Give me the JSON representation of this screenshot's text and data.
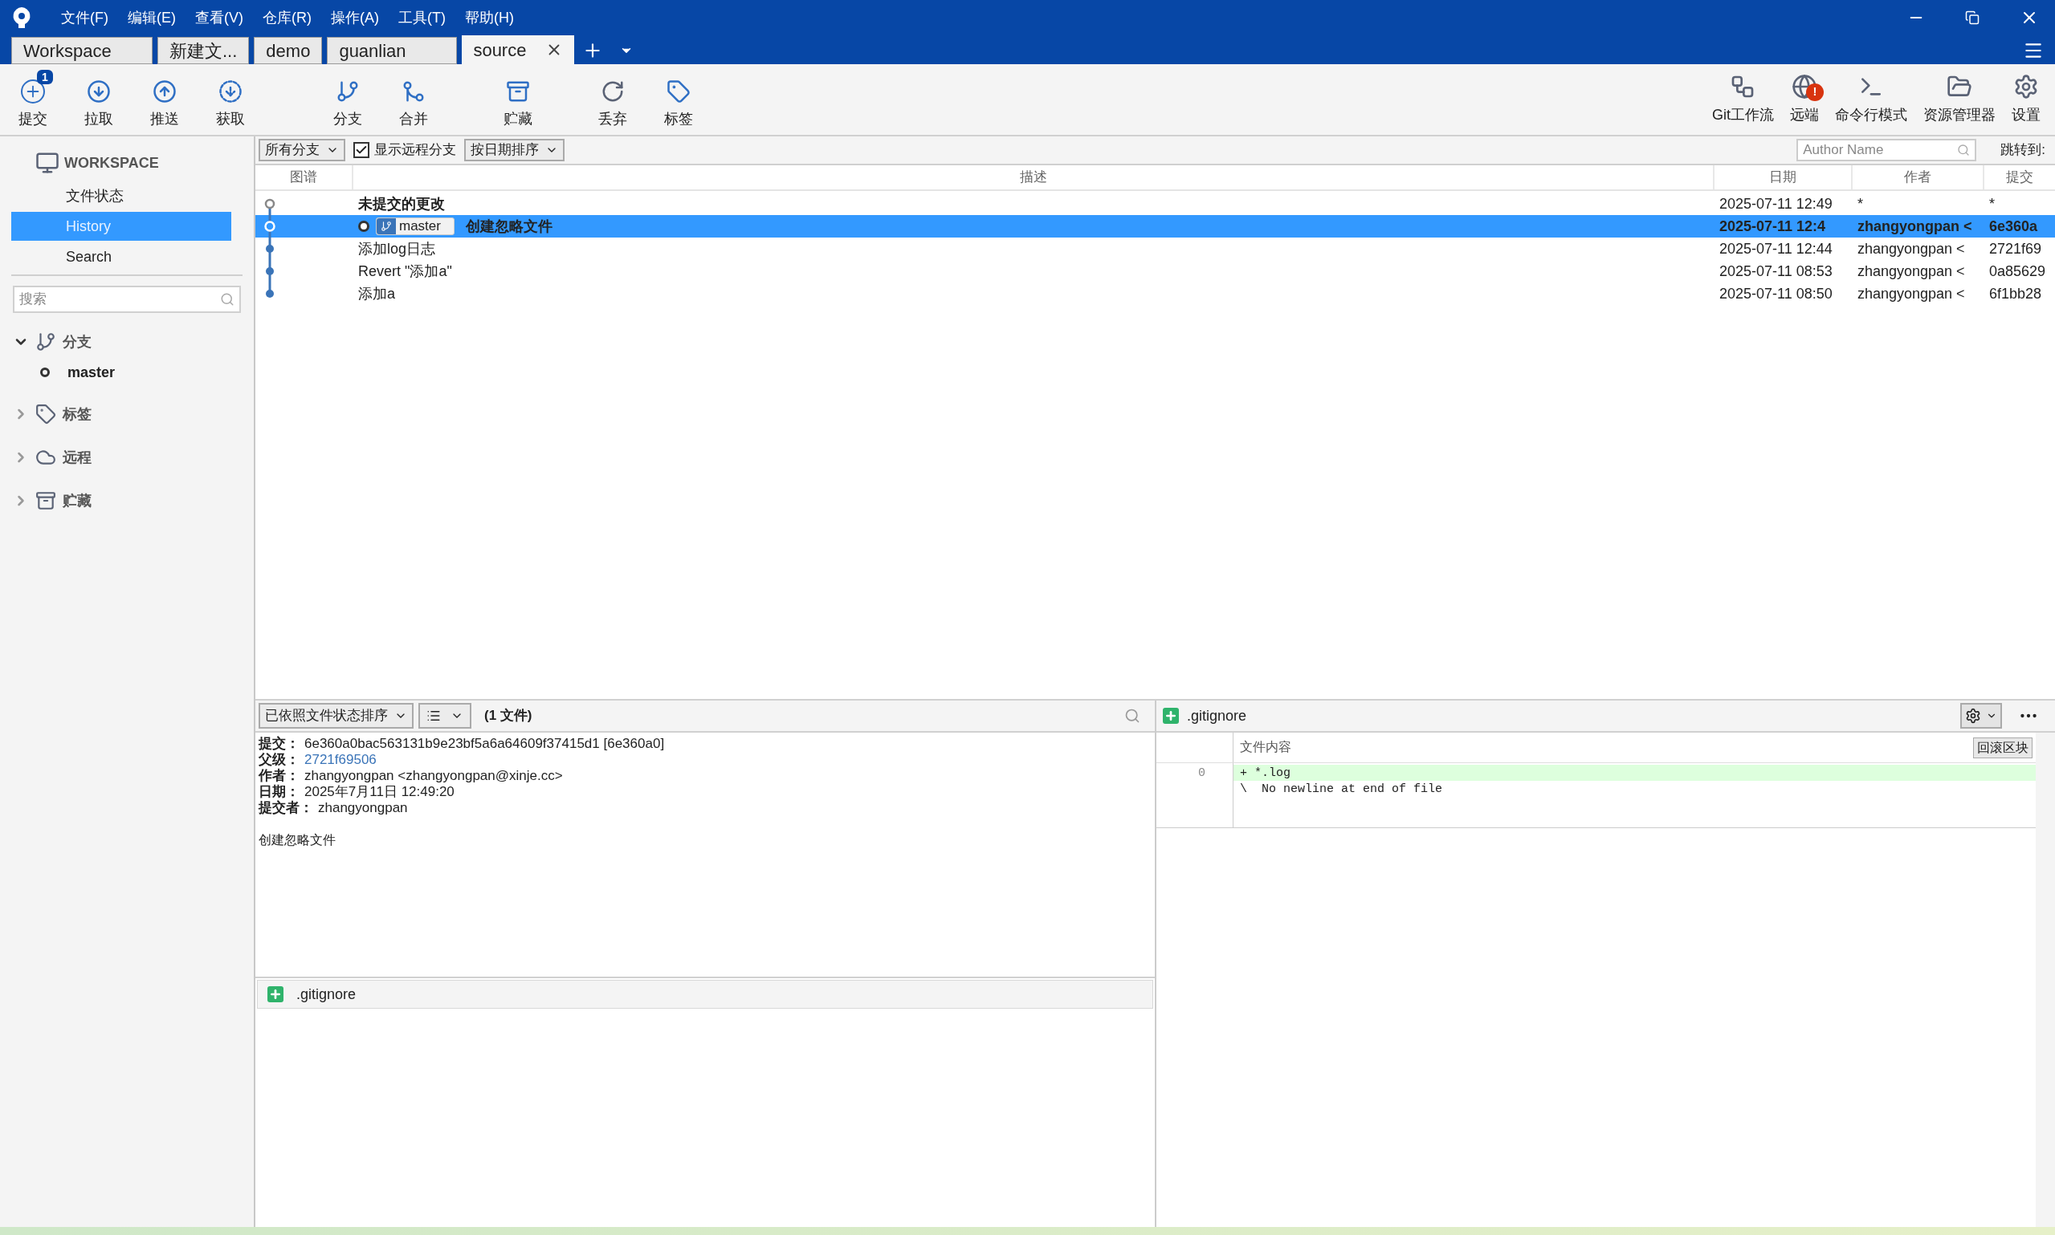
{
  "menu": [
    "文件(F)",
    "编辑(E)",
    "查看(V)",
    "仓库(R)",
    "操作(A)",
    "工具(T)",
    "帮助(H)"
  ],
  "tabs": [
    {
      "label": "Workspace",
      "selected": false
    },
    {
      "label": "新建文...",
      "selected": false
    },
    {
      "label": "demo",
      "selected": false
    },
    {
      "label": "guanlian",
      "selected": false
    },
    {
      "label": "source",
      "selected": true
    }
  ],
  "toolbar_left": [
    {
      "label": "提交",
      "kind": "commit",
      "badge": "1"
    },
    {
      "label": "拉取",
      "kind": "pull"
    },
    {
      "label": "推送",
      "kind": "push"
    },
    {
      "label": "获取",
      "kind": "fetch"
    },
    {
      "label": "分支",
      "kind": "branch"
    },
    {
      "label": "合并",
      "kind": "merge"
    },
    {
      "label": "贮藏",
      "kind": "stash"
    },
    {
      "label": "丢弃",
      "kind": "discard"
    },
    {
      "label": "标签",
      "kind": "tag"
    }
  ],
  "toolbar_right": [
    {
      "label": "Git工作流",
      "kind": "flow"
    },
    {
      "label": "远端",
      "kind": "remote",
      "alert": "!"
    },
    {
      "label": "命令行模式",
      "kind": "terminal"
    },
    {
      "label": "资源管理器",
      "kind": "explorer"
    },
    {
      "label": "设置",
      "kind": "settings"
    }
  ],
  "sidebar": {
    "workspace": "WORKSPACE",
    "items": [
      {
        "label": "文件状态",
        "selected": false
      },
      {
        "label": "History",
        "selected": true
      },
      {
        "label": "Search",
        "selected": false
      }
    ],
    "search": {
      "placeholder": "搜索"
    },
    "sections": [
      {
        "label": "分支",
        "kind": "branch",
        "expanded": true,
        "children": [
          {
            "label": "master"
          }
        ]
      },
      {
        "label": "标签",
        "kind": "tag",
        "expanded": false
      },
      {
        "label": "远程",
        "kind": "remote",
        "expanded": false
      },
      {
        "label": "贮藏",
        "kind": "stash",
        "expanded": false
      }
    ]
  },
  "filter_bar": {
    "branches": "所有分支",
    "show_remote": {
      "label": "显示远程分支",
      "checked": true
    },
    "sort": "按日期排序",
    "author_filter": {
      "placeholder": "Author Name"
    },
    "jump_label": "跳转到:"
  },
  "columns": [
    "图谱",
    "描述",
    "日期",
    "作者",
    "提交"
  ],
  "rows": [
    {
      "kind": "uncommitted",
      "description": "未提交的更改",
      "date": "2025-07-11 12:49",
      "author": "*",
      "commit": "*",
      "selected": false
    },
    {
      "kind": "commit",
      "branch": "master",
      "description": "创建忽略文件",
      "date": "2025-07-11 12:4",
      "author": "zhangyongpan <",
      "commit": "6e360a",
      "selected": true
    },
    {
      "kind": "commit",
      "description": "添加log日志",
      "date": "2025-07-11 12:44",
      "author": "zhangyongpan <",
      "commit": "2721f69",
      "selected": false
    },
    {
      "kind": "commit",
      "description": "Revert \"添加a\"",
      "date": "2025-07-11 08:53",
      "author": "zhangyongpan <",
      "commit": "0a85629",
      "selected": false
    },
    {
      "kind": "commit",
      "description": "添加a",
      "date": "2025-07-11 08:50",
      "author": "zhangyongpan <",
      "commit": "6f1bb28",
      "selected": false
    }
  ],
  "details": {
    "sort": "已依照文件状态排序",
    "file_count": "(1 文件)",
    "fields": [
      {
        "label": "提交：",
        "value": "6e360a0bac563131b9e23bf5a6a64609f37415d1 [6e360a0]"
      },
      {
        "label": "父级：",
        "value": "2721f69506",
        "kind": "link"
      },
      {
        "label": "作者：",
        "value": "zhangyongpan <zhangyongpan@xinje.cc>"
      },
      {
        "label": "日期：",
        "value": "2025年7月11日 12:49:20"
      },
      {
        "label": "提交者：",
        "value": "zhangyongpan"
      }
    ],
    "message": "创建忽略文件",
    "files": [
      {
        "name": ".gitignore",
        "kind": "added"
      }
    ]
  },
  "diff": {
    "file": ".gitignore",
    "kind": "added",
    "header": "文件内容",
    "revert_button": "回滚区块",
    "lines": [
      {
        "number": "0",
        "text": "+ *.log",
        "kind": "added"
      },
      {
        "text": "\\  No newline at end of file",
        "kind": "context"
      }
    ]
  }
}
